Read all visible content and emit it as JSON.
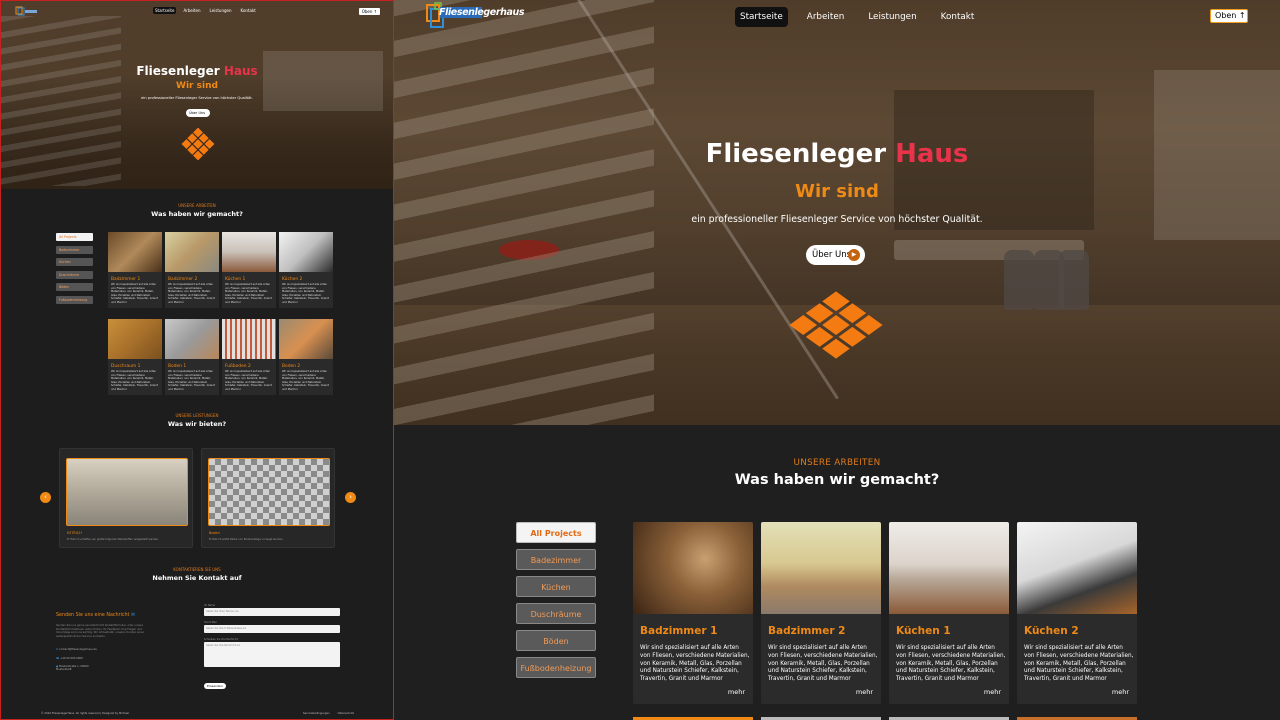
{
  "nav": {
    "logo_text": "Fliesenlegerhaus",
    "items": [
      {
        "label": "Startseite",
        "active": true
      },
      {
        "label": "Arbeiten",
        "active": false
      },
      {
        "label": "Leistungen",
        "active": false
      },
      {
        "label": "Kontakt",
        "active": false
      }
    ],
    "oben": "Oben"
  },
  "hero": {
    "title_a": "Fliesenleger",
    "title_b": "Haus",
    "subtitle": "Wir sind",
    "tagline": "ein professioneller Fliesenleger Service von höchster Qualität.",
    "cta": "Über Uns"
  },
  "works": {
    "small": "UNSERE ARBEITEN",
    "title": "Was haben wir gemacht?",
    "filters": [
      "All Projects",
      "Badezimmer",
      "Küchen",
      "Duschräume",
      "Böden",
      "Fußbodenheizung"
    ],
    "cards": [
      {
        "title": "Badzimmer 1",
        "text": "Wir sind spezialisiert auf alle Arten von Fliesen, verschiedene Materialien, von Keramik, Metall, Glas, Porzellan und Naturstein Schiefer, Kalkstein, Travertin, Granit und Marmor",
        "more": "mehr"
      },
      {
        "title": "Badzimmer 2",
        "text": "Wir sind spezialisiert auf alle Arten von Fliesen, verschiedene Materialien, von Keramik, Metall, Glas, Porzellan und Naturstein Schiefer, Kalkstein, Travertin, Granit und Marmor",
        "more": "mehr"
      },
      {
        "title": "Küchen 1",
        "text": "Wir sind spezialisiert auf alle Arten von Fliesen, verschiedene Materialien, von Keramik, Metall, Glas, Porzellan und Naturstein Schiefer, Kalkstein, Travertin, Granit und Marmor",
        "more": "mehr"
      },
      {
        "title": "Küchen 2",
        "text": "Wir sind spezialisiert auf alle Arten von Fliesen, verschiedene Materialien, von Keramik, Metall, Glas, Porzellan und Naturstein Schiefer, Kalkstein, Travertin, Granit und Marmor",
        "more": "mehr"
      }
    ],
    "thumb_cards_row2": [
      "Duschraum 1",
      "Boden 1",
      "Fußboden 2",
      "Boden 2"
    ]
  },
  "services": {
    "small": "UNSERE LEISTUNGEN",
    "title": "Was wir bieten?",
    "items": [
      {
        "title": "ESTRICH",
        "text": "Er Estrich schaffen ein glatte folgende Werkstoffen aufgestellt werden."
      },
      {
        "title": "Boden",
        "text": "Er Estrich wählt Reihe von Bodenbeläge vorwegt werden."
      }
    ]
  },
  "contact": {
    "small": "KONTAKTIEREN SIE UNS",
    "title": "Nehmen Sie Kontakt auf",
    "heading": "Senden Sie uns eine Nachricht",
    "intro": "Senden Sie uns gerne eine Nachricht Kontaktformular, oder unsere Kontaktinformationen unten finden. Ihr Feedback, Ihre Fragen und Vorschläge sind uns wichtig. Wir ist bestrebt, unseren Kunden einen außergewöhnlichen Service zu bieten.",
    "email": "contact@fliesenlegerhaus.de",
    "phone": "+49 00 000 0000",
    "address": "Musterstraße 1, 00000 Musterstadt",
    "form_labels": [
      "Ihr Name",
      "Ihre E-Mail",
      "Schreiben Sie Ihre Nachricht"
    ],
    "form_placeholders": [
      "Geben Sie Ihren Namen ein",
      "Geben Sie Ihre E-Mail-Adresse ein",
      "Geben Sie Ihre Nachricht ein"
    ],
    "submit": "Einsenden"
  },
  "footer": {
    "copy": "© 2024 FliesenlegerHaus. All rights reserved | Designed by Michael",
    "links": [
      "Servicebedingungen",
      "Datenschutz"
    ]
  },
  "colors": {
    "accent": "#f08a16",
    "red": "#e8334a",
    "bg": "#1f1f1f"
  }
}
